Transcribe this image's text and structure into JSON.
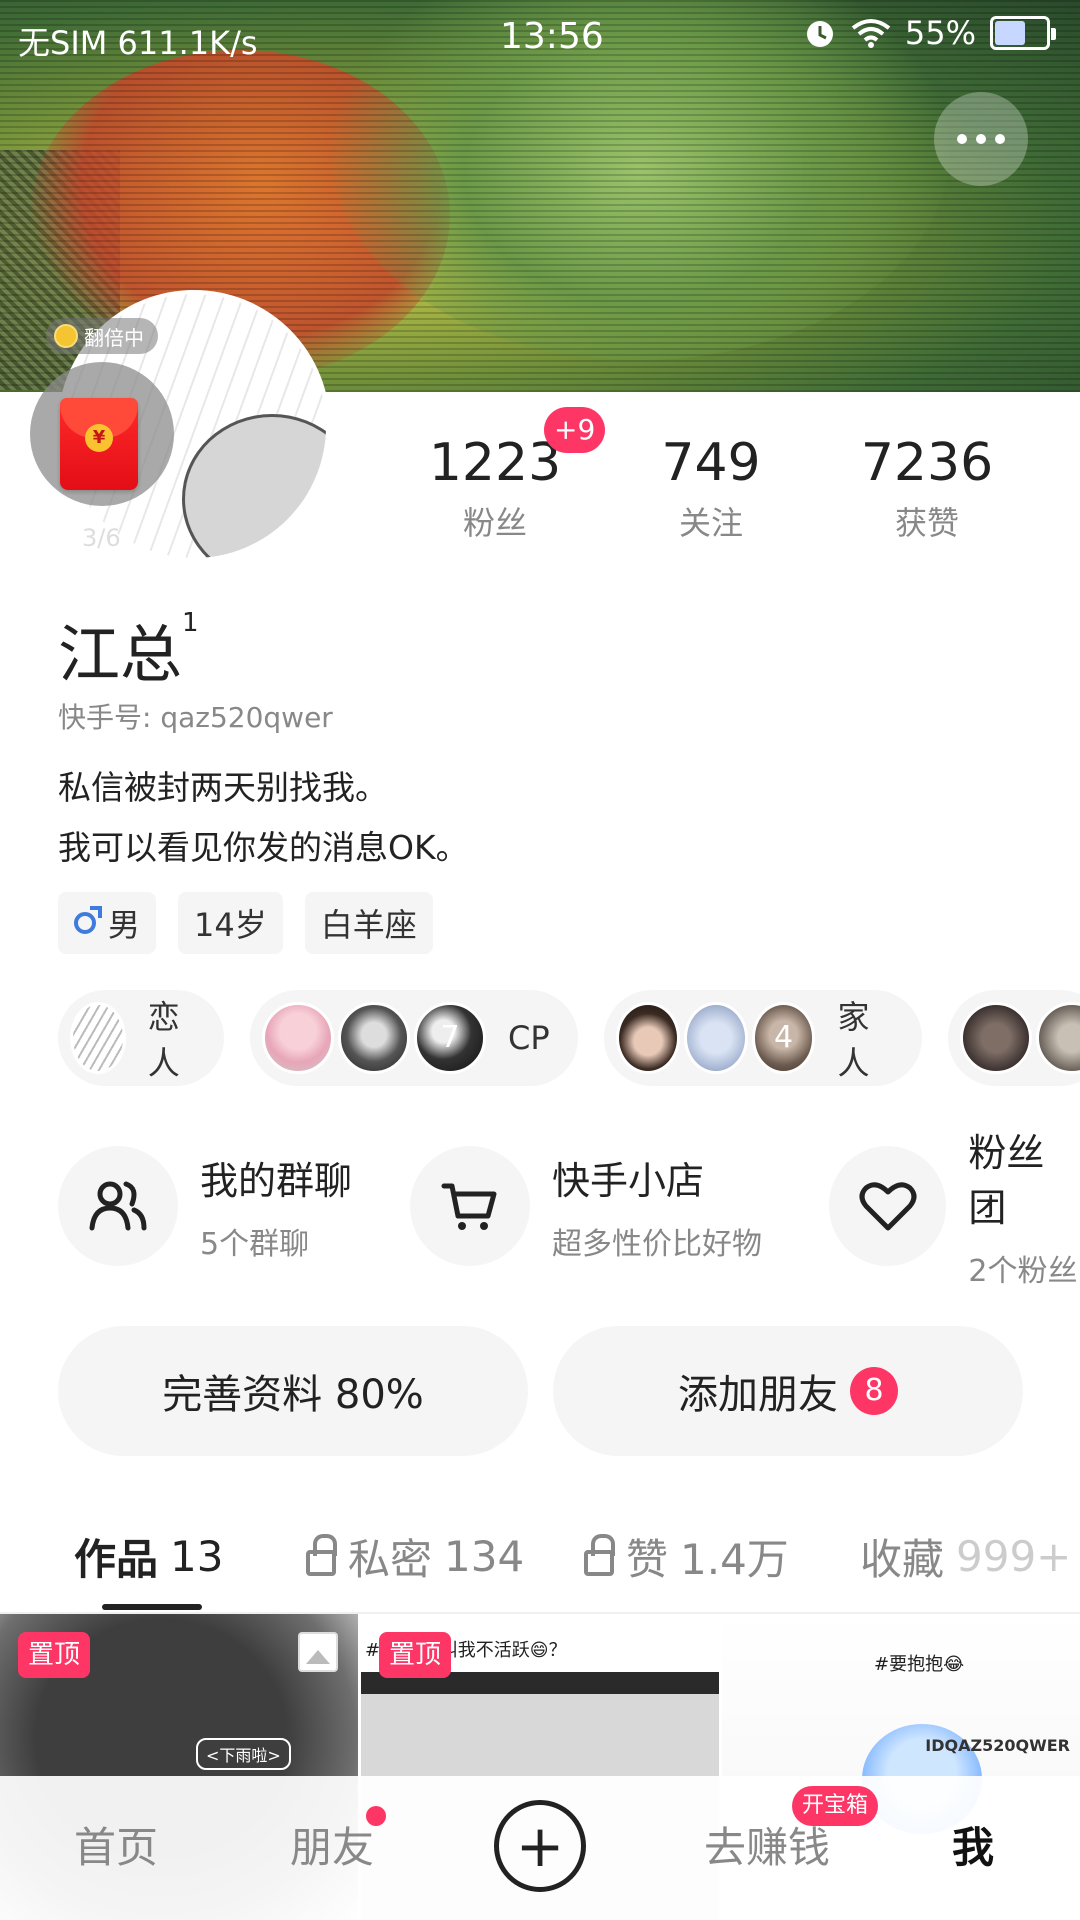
{
  "status_bar": {
    "left": "无SIM 611.1K/s",
    "time": "13:56",
    "battery": "55%",
    "battery_level": 0.55
  },
  "profile": {
    "coin_tag": "翻倍中",
    "redpack_count": "3/6",
    "name": "江总",
    "name_sup": "1",
    "kwai_id": "快手号: qaz520qwer",
    "bio_line1": "私信被封两天别找我。",
    "bio_line2": "我可以看见你发的消息OK。",
    "tags": [
      "男",
      "14岁",
      "白羊座"
    ]
  },
  "stats": {
    "fans_num": "1223",
    "fans_label": "粉丝",
    "fans_badge": "+9",
    "follow_num": "749",
    "follow_label": "关注",
    "likes_num": "7236",
    "likes_label": "获赞"
  },
  "relations": [
    {
      "label": "恋人"
    },
    {
      "label": "CP",
      "count": "7"
    },
    {
      "label": "家人",
      "count": "4"
    }
  ],
  "shortcuts": [
    {
      "title": "我的群聊",
      "sub": "5个群聊",
      "icon": "group-icon"
    },
    {
      "title": "快手小店",
      "sub": "超多性价比好物",
      "icon": "cart-icon"
    },
    {
      "title": "粉丝团",
      "sub": "2个粉丝",
      "icon": "heart-icon"
    }
  ],
  "actions": {
    "complete_profile": "完善资料 80%",
    "add_friend": "添加朋友",
    "add_friend_badge": "8"
  },
  "tabs": {
    "works": "作品",
    "works_count": "13",
    "private": "私密",
    "private_count": "134",
    "likes": "赞",
    "likes_count": "1.4万",
    "fav": "收藏",
    "fav_count": "999+"
  },
  "grid": {
    "pin_label": "置顶",
    "cell1_caption": "<下雨啦>",
    "cell2_caption": "#您总是 叫我不活跃😄？",
    "cell3_caption": "#要抱抱😂",
    "cell3_id": "IDQAZ520QWER"
  },
  "nav": {
    "home": "首页",
    "friends": "朋友",
    "plus": "+",
    "earn": "去赚钱",
    "earn_badge": "开宝箱",
    "me": "我"
  },
  "colors": {
    "accent": "#fe3666",
    "text": "#222222",
    "muted": "#888888",
    "chip_bg": "#f5f5f5"
  }
}
